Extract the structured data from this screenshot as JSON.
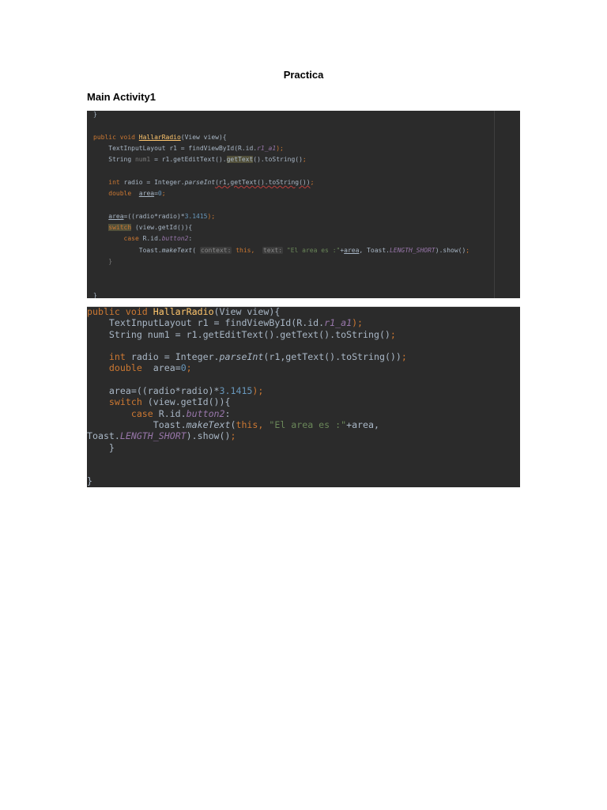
{
  "document": {
    "title": "Practica",
    "heading": "Main Activity1"
  },
  "code_blocks": [
    {
      "name": "ide-screenshot-code",
      "lines": [
        [
          [
            "}",
            ""
          ]
        ],
        [],
        [
          [
            "public void ",
            "kw"
          ],
          [
            "HallarRadio",
            "fnu"
          ],
          [
            "(View view){",
            ""
          ]
        ],
        [
          [
            "    TextInputLayout r1 = findViewById(R.id.",
            ""
          ],
          [
            "r1_a1",
            "it"
          ],
          [
            ");",
            "kw"
          ]
        ],
        [
          [
            "    String ",
            ""
          ],
          [
            "num1",
            "dim"
          ],
          [
            " = r1.getEditText().",
            ""
          ],
          [
            "getText",
            "hl"
          ],
          [
            "().toString()",
            ""
          ],
          [
            ";",
            "kw"
          ]
        ],
        [],
        [
          [
            "    ",
            ""
          ],
          [
            "int",
            "kw"
          ],
          [
            " radio = Integer.",
            ""
          ],
          [
            "parseInt",
            "mi"
          ],
          [
            "(r1,getText().toString())",
            "err"
          ],
          [
            ";",
            "kw"
          ]
        ],
        [
          [
            "    ",
            ""
          ],
          [
            "double",
            "kw"
          ],
          [
            "  ",
            ""
          ],
          [
            "area",
            "ul"
          ],
          [
            "=",
            ""
          ],
          [
            "0",
            "num"
          ],
          [
            ";",
            "kw"
          ]
        ],
        [],
        [
          [
            "    ",
            ""
          ],
          [
            "area",
            "ul"
          ],
          [
            "=((radio*radio)*",
            ""
          ],
          [
            "3.1415",
            "num"
          ],
          [
            ");",
            "kw"
          ]
        ],
        [
          [
            "    ",
            ""
          ],
          [
            "switch",
            "kwhl"
          ],
          [
            " (view.getId()){",
            ""
          ]
        ],
        [
          [
            "        ",
            ""
          ],
          [
            "case",
            "kw"
          ],
          [
            " R.id.",
            ""
          ],
          [
            "button2",
            "it"
          ],
          [
            ":",
            ""
          ]
        ],
        [
          [
            "            Toast.",
            ""
          ],
          [
            "makeText",
            "mi"
          ],
          [
            "( ",
            ""
          ],
          [
            "context:",
            "hint"
          ],
          [
            " ",
            ""
          ],
          [
            "this,",
            "kw"
          ],
          [
            "  ",
            ""
          ],
          [
            "text:",
            "hint"
          ],
          [
            " ",
            ""
          ],
          [
            "\"El area es :\"",
            "str"
          ],
          [
            "+",
            ""
          ],
          [
            "area",
            "ul"
          ],
          [
            ", Toast.",
            ""
          ],
          [
            "LENGTH_SHORT",
            "it"
          ],
          [
            ").show()",
            ""
          ],
          [
            ";",
            "kw"
          ]
        ],
        [
          [
            "    }",
            "dim"
          ]
        ],
        [],
        [],
        [
          [
            "}",
            ""
          ]
        ]
      ]
    },
    {
      "name": "copied-code",
      "lines": [
        [
          [
            "public void ",
            "kw"
          ],
          [
            "HallarRadio",
            "fn"
          ],
          [
            "(View view){",
            ""
          ]
        ],
        [
          [
            "    TextInputLayout r1 = findViewById(R.id.",
            ""
          ],
          [
            "r1_a1",
            "it"
          ],
          [
            ");",
            "kw"
          ]
        ],
        [
          [
            "    String num1 = r1.getEditText().getText().toString()",
            ""
          ],
          [
            ";",
            "kw"
          ]
        ],
        [],
        [
          [
            "    ",
            ""
          ],
          [
            "int",
            "kw"
          ],
          [
            " radio = Integer.",
            ""
          ],
          [
            "parseInt",
            "mi"
          ],
          [
            "(r1,getText().toString())",
            ""
          ],
          [
            ";",
            "kw"
          ]
        ],
        [
          [
            "    ",
            ""
          ],
          [
            "double",
            "kw"
          ],
          [
            "  area=",
            ""
          ],
          [
            "0",
            "num"
          ],
          [
            ";",
            "kw"
          ]
        ],
        [],
        [
          [
            "    area=((radio*radio)*",
            ""
          ],
          [
            "3.1415",
            "num"
          ],
          [
            ");",
            "kw"
          ]
        ],
        [
          [
            "    ",
            ""
          ],
          [
            "switch",
            "kw"
          ],
          [
            " (view.getId()){",
            ""
          ]
        ],
        [
          [
            "        ",
            ""
          ],
          [
            "case",
            "kw"
          ],
          [
            " R.id.",
            ""
          ],
          [
            "button2",
            "it"
          ],
          [
            ":",
            ""
          ]
        ],
        [
          [
            "            Toast.",
            ""
          ],
          [
            "makeText",
            "mi"
          ],
          [
            "(",
            ""
          ],
          [
            "this,",
            "kw"
          ],
          [
            " ",
            ""
          ],
          [
            "\"El area es :\"",
            "str"
          ],
          [
            "+area,",
            ""
          ]
        ],
        [
          [
            "Toast.",
            ""
          ],
          [
            "LENGTH_SHORT",
            "it"
          ],
          [
            ").show()",
            ""
          ],
          [
            ";",
            "kw"
          ]
        ],
        [
          [
            "    }",
            ""
          ]
        ],
        [],
        [],
        [
          [
            "}",
            ""
          ]
        ]
      ]
    }
  ]
}
